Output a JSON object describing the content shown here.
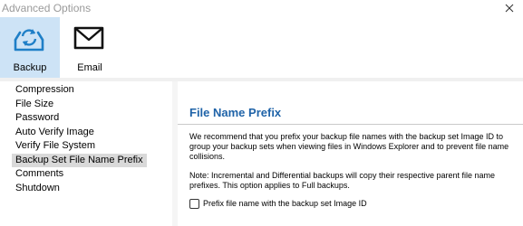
{
  "window": {
    "title": "Advanced Options",
    "close_glyph": "✕"
  },
  "toolbar": {
    "items": [
      {
        "label": "Backup",
        "icon": "backup-icon",
        "selected": true
      },
      {
        "label": "Email",
        "icon": "email-icon",
        "selected": false
      }
    ]
  },
  "sidebar": {
    "items": [
      {
        "label": "Compression"
      },
      {
        "label": "File Size"
      },
      {
        "label": "Password"
      },
      {
        "label": "Auto Verify Image"
      },
      {
        "label": "Verify File System"
      },
      {
        "label": "Backup Set File Name Prefix",
        "selected": true
      },
      {
        "label": "Comments"
      },
      {
        "label": "Shutdown"
      }
    ]
  },
  "panel": {
    "title": "File Name Prefix",
    "description": "We recommend that you prefix your backup file names with the backup set Image ID to group your backup sets when viewing files in Windows Explorer and to prevent file name collisions.",
    "note": "Note: Incremental and Differential backups will copy their respective parent file name prefixes. This option applies to Full backups.",
    "checkbox": {
      "label": "Prefix file name with the backup set Image ID",
      "checked": false
    }
  },
  "colors": {
    "accent": "#1f63a8",
    "selected_tool_bg": "#cde3f6",
    "selected_nav_bg": "#d9d9d9"
  }
}
